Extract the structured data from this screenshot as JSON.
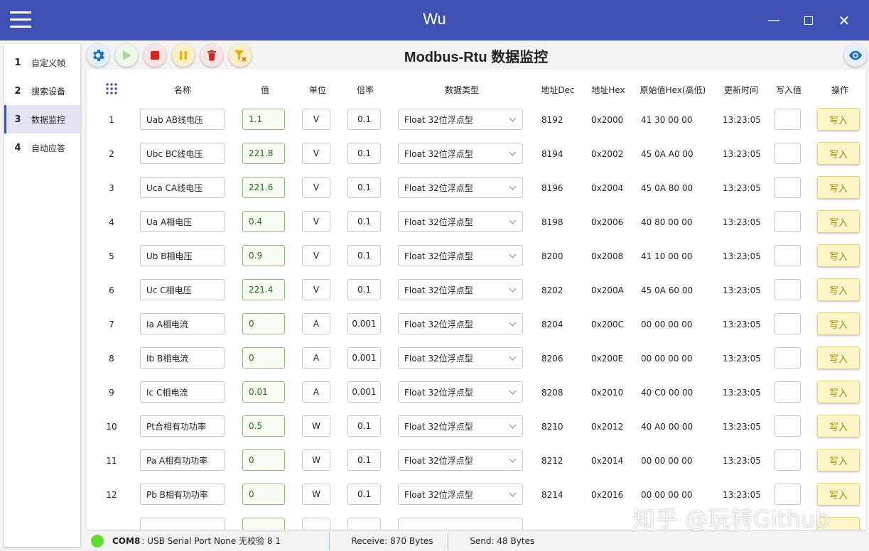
{
  "window": {
    "title": "Wu"
  },
  "sidebar": {
    "items": [
      {
        "num": "1",
        "label": "自定义帧"
      },
      {
        "num": "2",
        "label": "搜索设备"
      },
      {
        "num": "3",
        "label": "数据监控"
      },
      {
        "num": "4",
        "label": "自动应答"
      }
    ]
  },
  "main": {
    "title": "Modbus-Rtu 数据监控"
  },
  "table": {
    "headers": {
      "name": "名称",
      "value": "值",
      "unit": "单位",
      "scale": "倍率",
      "dtype": "数据类型",
      "addr_dec": "地址Dec",
      "addr_hex": "地址Hex",
      "raw": "原始值Hex(高低)",
      "time": "更新时间",
      "write_val": "写入值",
      "op": "操作"
    },
    "write_label": "写入",
    "rows": [
      {
        "idx": "1",
        "name": "Uab AB线电压",
        "value": "1.1",
        "unit": "V",
        "scale": "0.1",
        "dtype": "Float 32位浮点型",
        "dec": "8192",
        "hex": "0x2000",
        "raw": "41 30 00 00",
        "time": "13:23:05"
      },
      {
        "idx": "2",
        "name": "Ubc BC线电压",
        "value": "221.8",
        "unit": "V",
        "scale": "0.1",
        "dtype": "Float 32位浮点型",
        "dec": "8194",
        "hex": "0x2002",
        "raw": "45 0A A0 00",
        "time": "13:23:05"
      },
      {
        "idx": "3",
        "name": "Uca CA线电压",
        "value": "221.6",
        "unit": "V",
        "scale": "0.1",
        "dtype": "Float 32位浮点型",
        "dec": "8196",
        "hex": "0x2004",
        "raw": "45 0A 80 00",
        "time": "13:23:05"
      },
      {
        "idx": "4",
        "name": "Ua A相电压",
        "value": "0.4",
        "unit": "V",
        "scale": "0.1",
        "dtype": "Float 32位浮点型",
        "dec": "8198",
        "hex": "0x2006",
        "raw": "40 80 00 00",
        "time": "13:23:05"
      },
      {
        "idx": "5",
        "name": "Ub B相电压",
        "value": "0.9",
        "unit": "V",
        "scale": "0.1",
        "dtype": "Float 32位浮点型",
        "dec": "8200",
        "hex": "0x2008",
        "raw": "41 10 00 00",
        "time": "13:23:05"
      },
      {
        "idx": "6",
        "name": "Uc C相电压",
        "value": "221.4",
        "unit": "V",
        "scale": "0.1",
        "dtype": "Float 32位浮点型",
        "dec": "8202",
        "hex": "0x200A",
        "raw": "45 0A 60 00",
        "time": "13:23:05"
      },
      {
        "idx": "7",
        "name": "Ia A相电流",
        "value": "0",
        "unit": "A",
        "scale": "0.001",
        "dtype": "Float 32位浮点型",
        "dec": "8204",
        "hex": "0x200C",
        "raw": "00 00 00 00",
        "time": "13:23:05"
      },
      {
        "idx": "8",
        "name": "Ib B相电流",
        "value": "0",
        "unit": "A",
        "scale": "0.001",
        "dtype": "Float 32位浮点型",
        "dec": "8206",
        "hex": "0x200E",
        "raw": "00 00 00 00",
        "time": "13:23:05"
      },
      {
        "idx": "9",
        "name": "Ic C相电流",
        "value": "0.01",
        "unit": "A",
        "scale": "0.001",
        "dtype": "Float 32位浮点型",
        "dec": "8208",
        "hex": "0x2010",
        "raw": "40 C0 00 00",
        "time": "13:23:05"
      },
      {
        "idx": "10",
        "name": "Pt合相有功功率",
        "value": "0.5",
        "unit": "W",
        "scale": "0.1",
        "dtype": "Float 32位浮点型",
        "dec": "8210",
        "hex": "0x2012",
        "raw": "40 A0 00 00",
        "time": "13:23:05"
      },
      {
        "idx": "11",
        "name": "Pa A相有功功率",
        "value": "0",
        "unit": "W",
        "scale": "0.1",
        "dtype": "Float 32位浮点型",
        "dec": "8212",
        "hex": "0x2014",
        "raw": "00 00 00 00",
        "time": "13:23:05"
      },
      {
        "idx": "12",
        "name": "Pb B相有功功率",
        "value": "0",
        "unit": "W",
        "scale": "0.1",
        "dtype": "Float 32位浮点型",
        "dec": "8214",
        "hex": "0x2016",
        "raw": "00 00 00 00",
        "time": "13:23:05"
      }
    ]
  },
  "status": {
    "port": "COM8",
    "port_desc": ": USB Serial Port  None   无校验  8  1",
    "receive": "Receive: 870 Bytes",
    "send": "Send: 48 Bytes"
  },
  "watermark": "知乎 @玩转Github",
  "colors": {
    "accent": "#3f51b5",
    "value_green": "#7cc36a",
    "write_button": "#fff6c8",
    "status_ok": "#5edd2a"
  }
}
